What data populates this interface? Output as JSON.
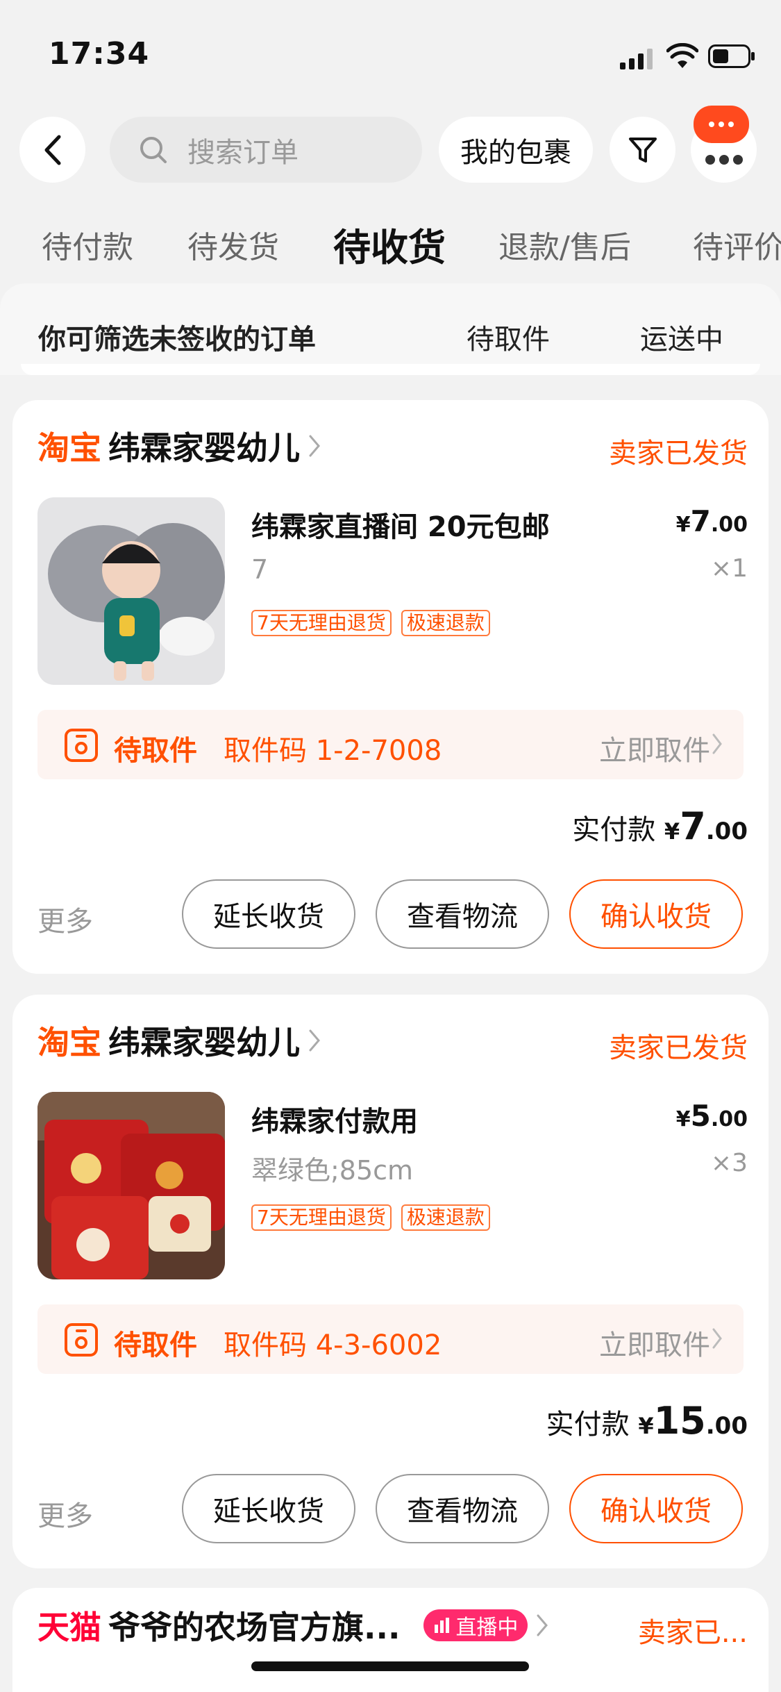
{
  "status_bar": {
    "time": "17:34"
  },
  "header": {
    "search_placeholder": "搜索订单",
    "packages_label": "我的包裹"
  },
  "tabs": [
    {
      "label": "待付款"
    },
    {
      "label": "待发货"
    },
    {
      "label": "待收货",
      "active": true
    },
    {
      "label": "退款/售后"
    },
    {
      "label": "待评价"
    }
  ],
  "filter": {
    "hint": "你可筛选未签收的订单",
    "options": [
      "待取件",
      "运送中"
    ]
  },
  "colors": {
    "accent": "#ff5000",
    "tmall": "#ff0036",
    "live": "#ff2a6d"
  },
  "orders": [
    {
      "platform": "淘宝",
      "shop": "纬霖家婴幼儿",
      "status": "卖家已发货",
      "item_title": "纬霖家直播间 20元包邮",
      "item_spec": "7",
      "price_int": "7",
      "price_dec": ".00",
      "qty": "×1",
      "tags": [
        "7天无理由退货",
        "极速退款"
      ],
      "pickup_status": "待取件",
      "pickup_code": "取件码 1-2-7008",
      "pickup_action": "立即取件",
      "total_label": "实付款",
      "total_int": "7",
      "total_dec": ".00",
      "more": "更多",
      "buttons": [
        "延长收货",
        "查看物流",
        "确认收货"
      ]
    },
    {
      "platform": "淘宝",
      "shop": "纬霖家婴幼儿",
      "status": "卖家已发货",
      "item_title": "纬霖家付款用",
      "item_spec": "翠绿色;85cm",
      "price_int": "5",
      "price_dec": ".00",
      "qty": "×3",
      "tags": [
        "7天无理由退货",
        "极速退款"
      ],
      "pickup_status": "待取件",
      "pickup_code": "取件码 4-3-6002",
      "pickup_action": "立即取件",
      "total_label": "实付款",
      "total_int": "15",
      "total_dec": ".00",
      "more": "更多",
      "buttons": [
        "延长收货",
        "查看物流",
        "确认收货"
      ]
    },
    {
      "platform": "天猫",
      "shop": "爷爷的农场官方旗...",
      "live_label": "直播中",
      "status": "卖家已..."
    }
  ],
  "currency_symbol": "¥"
}
